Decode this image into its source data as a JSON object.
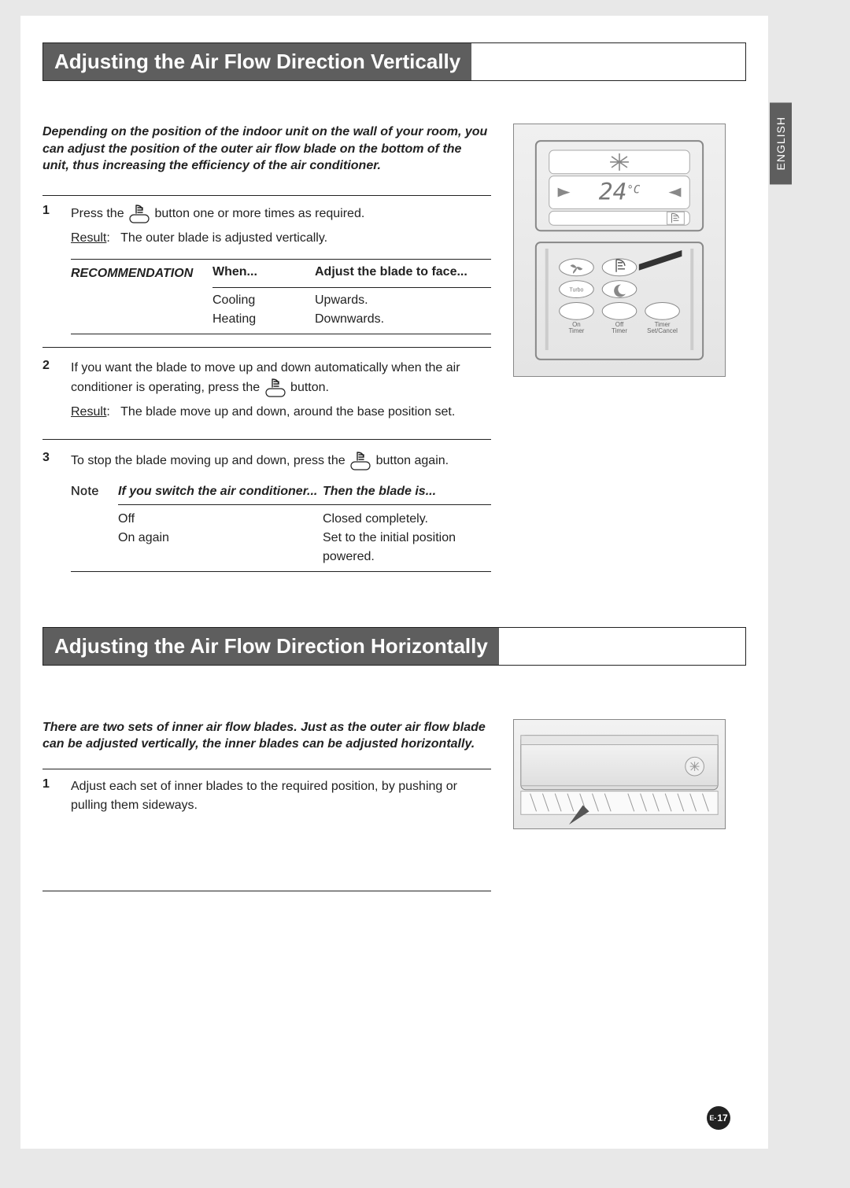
{
  "language_tab": "ENGLISH",
  "section1": {
    "title": "Adjusting the Air Flow Direction Vertically",
    "intro": "Depending on the position of the indoor unit on the wall of your room, you can adjust the position of the outer air flow blade on the bottom of the unit, thus increasing the efficiency of the air conditioner.",
    "step1": {
      "num": "1",
      "text_a": "Press the ",
      "text_b": " button one or more times as required.",
      "result_label": "Result",
      "result_text": "The outer blade is adjusted vertically."
    },
    "recommendation": {
      "label": "RECOMMENDATION",
      "col_a": "When...",
      "col_b": "Adjust the blade to face...",
      "rows": [
        {
          "a": "Cooling",
          "b": "Upwards."
        },
        {
          "a": "Heating",
          "b": "Downwards."
        }
      ]
    },
    "step2": {
      "num": "2",
      "text_a": "If you want the blade to move up and down automatically when the air conditioner is operating, press the ",
      "text_b": " button.",
      "result_label": "Result",
      "result_text": "The blade move up and down, around the base position set."
    },
    "step3": {
      "num": "3",
      "text_a": "To stop the blade moving up and down, press the ",
      "text_b": " button again."
    },
    "note": {
      "label": "Note",
      "col_a": "If you switch the air conditioner...",
      "col_b": "Then the blade is...",
      "rows": [
        {
          "a": "Off",
          "b": "Closed completely."
        },
        {
          "a": "On again",
          "b": "Set to the initial position powered."
        }
      ]
    }
  },
  "section2": {
    "title": "Adjusting the Air Flow Direction Horizontally",
    "intro": "There are two sets of inner air flow blades. Just as the outer air flow blade can be adjusted vertically, the inner blades can be adjusted horizontally.",
    "step1": {
      "num": "1",
      "text": "Adjust each set of inner blades to the required position, by pushing or pulling them sideways."
    }
  },
  "remote": {
    "display_temp": "24",
    "display_unit": "°C",
    "arrow": "→",
    "buttons": {
      "on_timer": "On\nTimer",
      "off_timer": "Off\nTimer",
      "set_cancel": "Timer\nSet/Cancel",
      "turbo": "Turbo"
    }
  },
  "page_number": {
    "prefix": "E-",
    "num": "17"
  },
  "icons": {
    "swing": "swing-button-icon",
    "snowflake": "snowflake-icon"
  }
}
